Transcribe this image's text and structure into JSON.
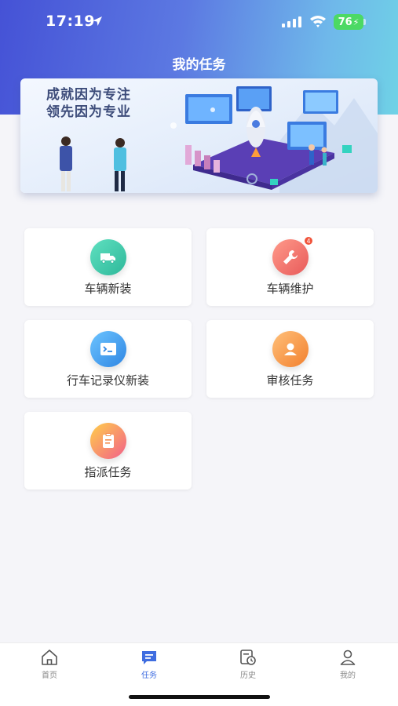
{
  "status": {
    "time": "17:19",
    "battery": "76"
  },
  "header": {
    "title": "我的任务"
  },
  "banner": {
    "line1": "成就因为专注",
    "line2": "领先因为专业"
  },
  "tasks": [
    {
      "label": "车辆新装",
      "icon": "truck-icon",
      "color": "#3ec8a7"
    },
    {
      "label": "车辆维护",
      "icon": "wrench-icon",
      "color": "#ef6c6c",
      "badge": "4"
    },
    {
      "label": "行车记录仪新装",
      "icon": "terminal-icon",
      "color": "#3d9ae8"
    },
    {
      "label": "审核任务",
      "icon": "user-review-icon",
      "color": "#f3913a"
    },
    {
      "label": "指派任务",
      "icon": "clipboard-icon",
      "color": "#f47d5a"
    }
  ],
  "tabbar": {
    "items": [
      {
        "label": "首页",
        "icon": "home-icon",
        "active": false
      },
      {
        "label": "任务",
        "icon": "task-icon",
        "active": true
      },
      {
        "label": "历史",
        "icon": "history-icon",
        "active": false
      },
      {
        "label": "我的",
        "icon": "profile-icon",
        "active": false
      }
    ]
  }
}
